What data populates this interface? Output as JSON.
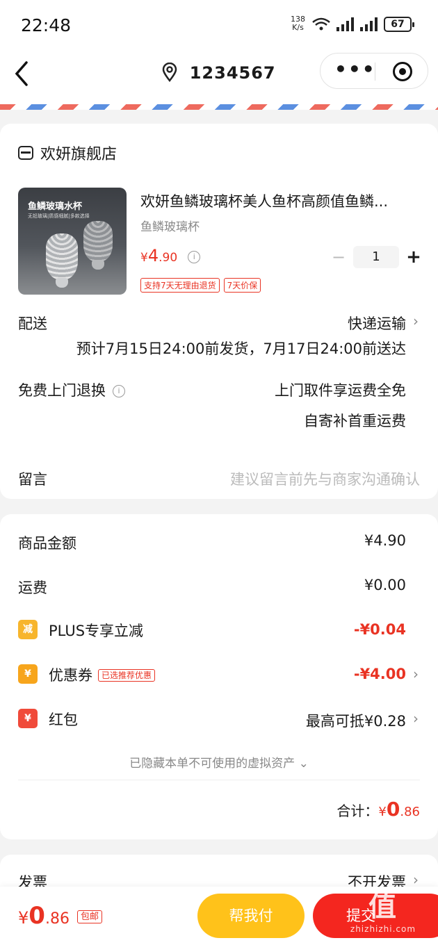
{
  "status_bar": {
    "time": "22:48",
    "net_speed": "138",
    "net_unit": "K/s",
    "battery": "67"
  },
  "nav": {
    "title": "1234567"
  },
  "shop": {
    "name": "欢妍旗舰店"
  },
  "product": {
    "title": "欢妍鱼鳞玻璃杯美人鱼杯高颜值鱼鳞...",
    "spec": "鱼鳞玻璃杯",
    "price_symbol": "¥",
    "price_int": "4",
    "price_dec": ".90",
    "qty": "1",
    "tags": [
      "支持7天无理由退货",
      "7天价保"
    ],
    "image_caption": "鱼鳞玻璃水杯",
    "image_subcaption": "无铅玻璃|质感细腻|多款选择"
  },
  "delivery": {
    "label": "配送",
    "method": "快递运输",
    "estimate": "预计7月15日24:00前发货，7月17日24:00前送达"
  },
  "free_return": {
    "label": "免费上门退换",
    "line1": "上门取件享运费全免",
    "line2": "自寄补首重运费"
  },
  "message": {
    "label": "留言",
    "placeholder": "建议留言前先与商家沟通确认"
  },
  "summary": {
    "goods_label": "商品金额",
    "goods_value": "¥4.90",
    "shipping_label": "运费",
    "shipping_value": "¥0.00",
    "plus_label": "PLUS专享立减",
    "plus_value": "-¥0.04",
    "plus_icon": "减",
    "coupon_label": "优惠券",
    "coupon_tag": "已选推荐优惠",
    "coupon_value": "-¥4.00",
    "coupon_icon": "¥",
    "redpacket_label": "红包",
    "redpacket_value": "最高可抵¥0.28",
    "redpacket_icon": "¥",
    "hidden_assets": "已隐藏本单不可使用的虚拟资产",
    "total_label": "合计：",
    "total_symbol": "¥",
    "total_int": "0",
    "total_dec": ".86"
  },
  "invoice": {
    "label": "发票",
    "value": "不开发票"
  },
  "bottom": {
    "price_symbol": "¥",
    "price_int": "0",
    "price_dec": ".86",
    "free_shipping": "包邮",
    "help_pay": "帮我付",
    "pay": "提交"
  },
  "watermark": {
    "big": "值",
    "small": "zhizhizhi.com"
  },
  "colors": {
    "accent_red": "#e93323",
    "help_yellow": "#ffc21a",
    "pay_red": "#f4261f",
    "coupon_orange": "#f7a51c"
  }
}
